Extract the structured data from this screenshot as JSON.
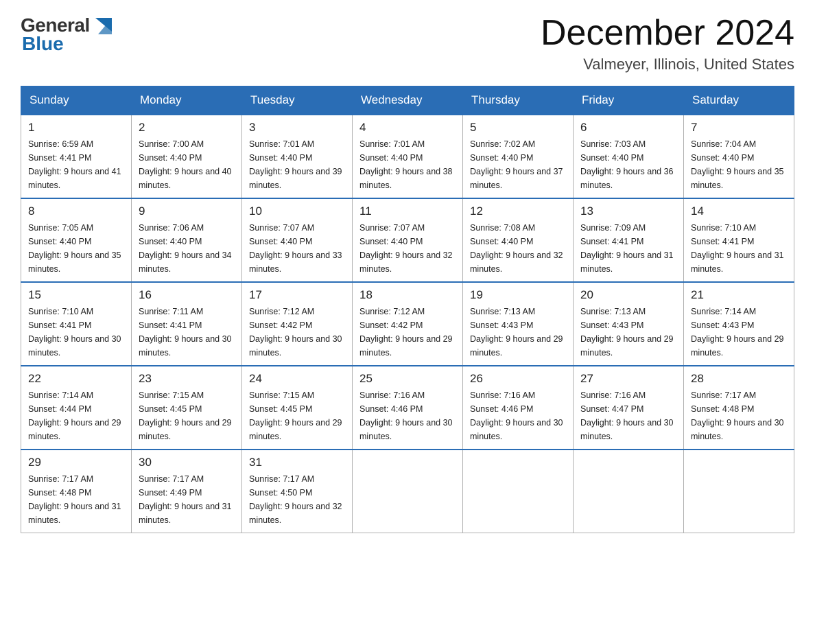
{
  "header": {
    "logo_general": "General",
    "logo_blue": "Blue",
    "title": "December 2024",
    "location": "Valmeyer, Illinois, United States"
  },
  "days_of_week": [
    "Sunday",
    "Monday",
    "Tuesday",
    "Wednesday",
    "Thursday",
    "Friday",
    "Saturday"
  ],
  "weeks": [
    [
      {
        "day": "1",
        "sunrise": "6:59 AM",
        "sunset": "4:41 PM",
        "daylight": "9 hours and 41 minutes."
      },
      {
        "day": "2",
        "sunrise": "7:00 AM",
        "sunset": "4:40 PM",
        "daylight": "9 hours and 40 minutes."
      },
      {
        "day": "3",
        "sunrise": "7:01 AM",
        "sunset": "4:40 PM",
        "daylight": "9 hours and 39 minutes."
      },
      {
        "day": "4",
        "sunrise": "7:01 AM",
        "sunset": "4:40 PM",
        "daylight": "9 hours and 38 minutes."
      },
      {
        "day": "5",
        "sunrise": "7:02 AM",
        "sunset": "4:40 PM",
        "daylight": "9 hours and 37 minutes."
      },
      {
        "day": "6",
        "sunrise": "7:03 AM",
        "sunset": "4:40 PM",
        "daylight": "9 hours and 36 minutes."
      },
      {
        "day": "7",
        "sunrise": "7:04 AM",
        "sunset": "4:40 PM",
        "daylight": "9 hours and 35 minutes."
      }
    ],
    [
      {
        "day": "8",
        "sunrise": "7:05 AM",
        "sunset": "4:40 PM",
        "daylight": "9 hours and 35 minutes."
      },
      {
        "day": "9",
        "sunrise": "7:06 AM",
        "sunset": "4:40 PM",
        "daylight": "9 hours and 34 minutes."
      },
      {
        "day": "10",
        "sunrise": "7:07 AM",
        "sunset": "4:40 PM",
        "daylight": "9 hours and 33 minutes."
      },
      {
        "day": "11",
        "sunrise": "7:07 AM",
        "sunset": "4:40 PM",
        "daylight": "9 hours and 32 minutes."
      },
      {
        "day": "12",
        "sunrise": "7:08 AM",
        "sunset": "4:40 PM",
        "daylight": "9 hours and 32 minutes."
      },
      {
        "day": "13",
        "sunrise": "7:09 AM",
        "sunset": "4:41 PM",
        "daylight": "9 hours and 31 minutes."
      },
      {
        "day": "14",
        "sunrise": "7:10 AM",
        "sunset": "4:41 PM",
        "daylight": "9 hours and 31 minutes."
      }
    ],
    [
      {
        "day": "15",
        "sunrise": "7:10 AM",
        "sunset": "4:41 PM",
        "daylight": "9 hours and 30 minutes."
      },
      {
        "day": "16",
        "sunrise": "7:11 AM",
        "sunset": "4:41 PM",
        "daylight": "9 hours and 30 minutes."
      },
      {
        "day": "17",
        "sunrise": "7:12 AM",
        "sunset": "4:42 PM",
        "daylight": "9 hours and 30 minutes."
      },
      {
        "day": "18",
        "sunrise": "7:12 AM",
        "sunset": "4:42 PM",
        "daylight": "9 hours and 29 minutes."
      },
      {
        "day": "19",
        "sunrise": "7:13 AM",
        "sunset": "4:43 PM",
        "daylight": "9 hours and 29 minutes."
      },
      {
        "day": "20",
        "sunrise": "7:13 AM",
        "sunset": "4:43 PM",
        "daylight": "9 hours and 29 minutes."
      },
      {
        "day": "21",
        "sunrise": "7:14 AM",
        "sunset": "4:43 PM",
        "daylight": "9 hours and 29 minutes."
      }
    ],
    [
      {
        "day": "22",
        "sunrise": "7:14 AM",
        "sunset": "4:44 PM",
        "daylight": "9 hours and 29 minutes."
      },
      {
        "day": "23",
        "sunrise": "7:15 AM",
        "sunset": "4:45 PM",
        "daylight": "9 hours and 29 minutes."
      },
      {
        "day": "24",
        "sunrise": "7:15 AM",
        "sunset": "4:45 PM",
        "daylight": "9 hours and 29 minutes."
      },
      {
        "day": "25",
        "sunrise": "7:16 AM",
        "sunset": "4:46 PM",
        "daylight": "9 hours and 30 minutes."
      },
      {
        "day": "26",
        "sunrise": "7:16 AM",
        "sunset": "4:46 PM",
        "daylight": "9 hours and 30 minutes."
      },
      {
        "day": "27",
        "sunrise": "7:16 AM",
        "sunset": "4:47 PM",
        "daylight": "9 hours and 30 minutes."
      },
      {
        "day": "28",
        "sunrise": "7:17 AM",
        "sunset": "4:48 PM",
        "daylight": "9 hours and 30 minutes."
      }
    ],
    [
      {
        "day": "29",
        "sunrise": "7:17 AM",
        "sunset": "4:48 PM",
        "daylight": "9 hours and 31 minutes."
      },
      {
        "day": "30",
        "sunrise": "7:17 AM",
        "sunset": "4:49 PM",
        "daylight": "9 hours and 31 minutes."
      },
      {
        "day": "31",
        "sunrise": "7:17 AM",
        "sunset": "4:50 PM",
        "daylight": "9 hours and 32 minutes."
      },
      null,
      null,
      null,
      null
    ]
  ]
}
